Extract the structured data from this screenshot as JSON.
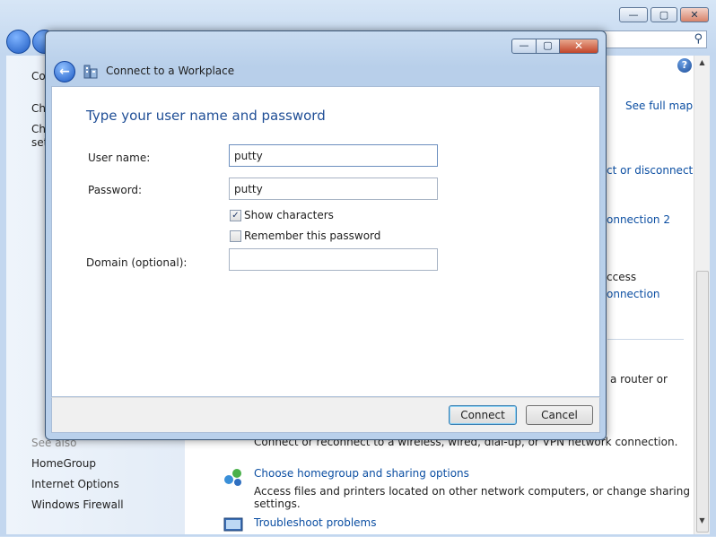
{
  "background_window": {
    "controls": {
      "minimize": "—",
      "maximize": "▢",
      "close": "✕"
    },
    "left_pane": {
      "partial_items": [
        "Co",
        "Ch",
        "Ch",
        "set"
      ],
      "see_also_label": "See also",
      "see_also_links": [
        "HomeGroup",
        "Internet Options",
        "Windows Firewall"
      ]
    },
    "main_pane": {
      "see_full_map": "See full map",
      "partial_texts": [
        "ct or disconnect",
        "onnection 2",
        "ccess",
        "onnection",
        "a router or"
      ],
      "connect_description": "Connect or reconnect to a wireless, wired, dial-up, or VPN network connection.",
      "homegroup_link": "Choose homegroup and sharing options",
      "homegroup_description": "Access files and printers located on other network computers, or change sharing settings.",
      "troubleshoot_link": "Troubleshoot problems"
    }
  },
  "dialog": {
    "title": "Connect to a Workplace",
    "controls": {
      "minimize": "—",
      "maximize": "▢",
      "close": "✕"
    },
    "heading": "Type your user name and password",
    "fields": {
      "username": {
        "label": "User name:",
        "value": "putty"
      },
      "password": {
        "label": "Password:",
        "value": "putty"
      },
      "domain": {
        "label": "Domain (optional):",
        "value": ""
      }
    },
    "checkboxes": {
      "show_characters": {
        "label": "Show characters",
        "checked": true,
        "mark": "✓"
      },
      "remember_password": {
        "label": "Remember this password",
        "checked": false,
        "mark": ""
      }
    },
    "buttons": {
      "connect": "Connect",
      "cancel": "Cancel"
    }
  },
  "colors": {
    "link": "#0b4ea2",
    "heading": "#1f4e96",
    "accent": "#3c7fb1"
  }
}
